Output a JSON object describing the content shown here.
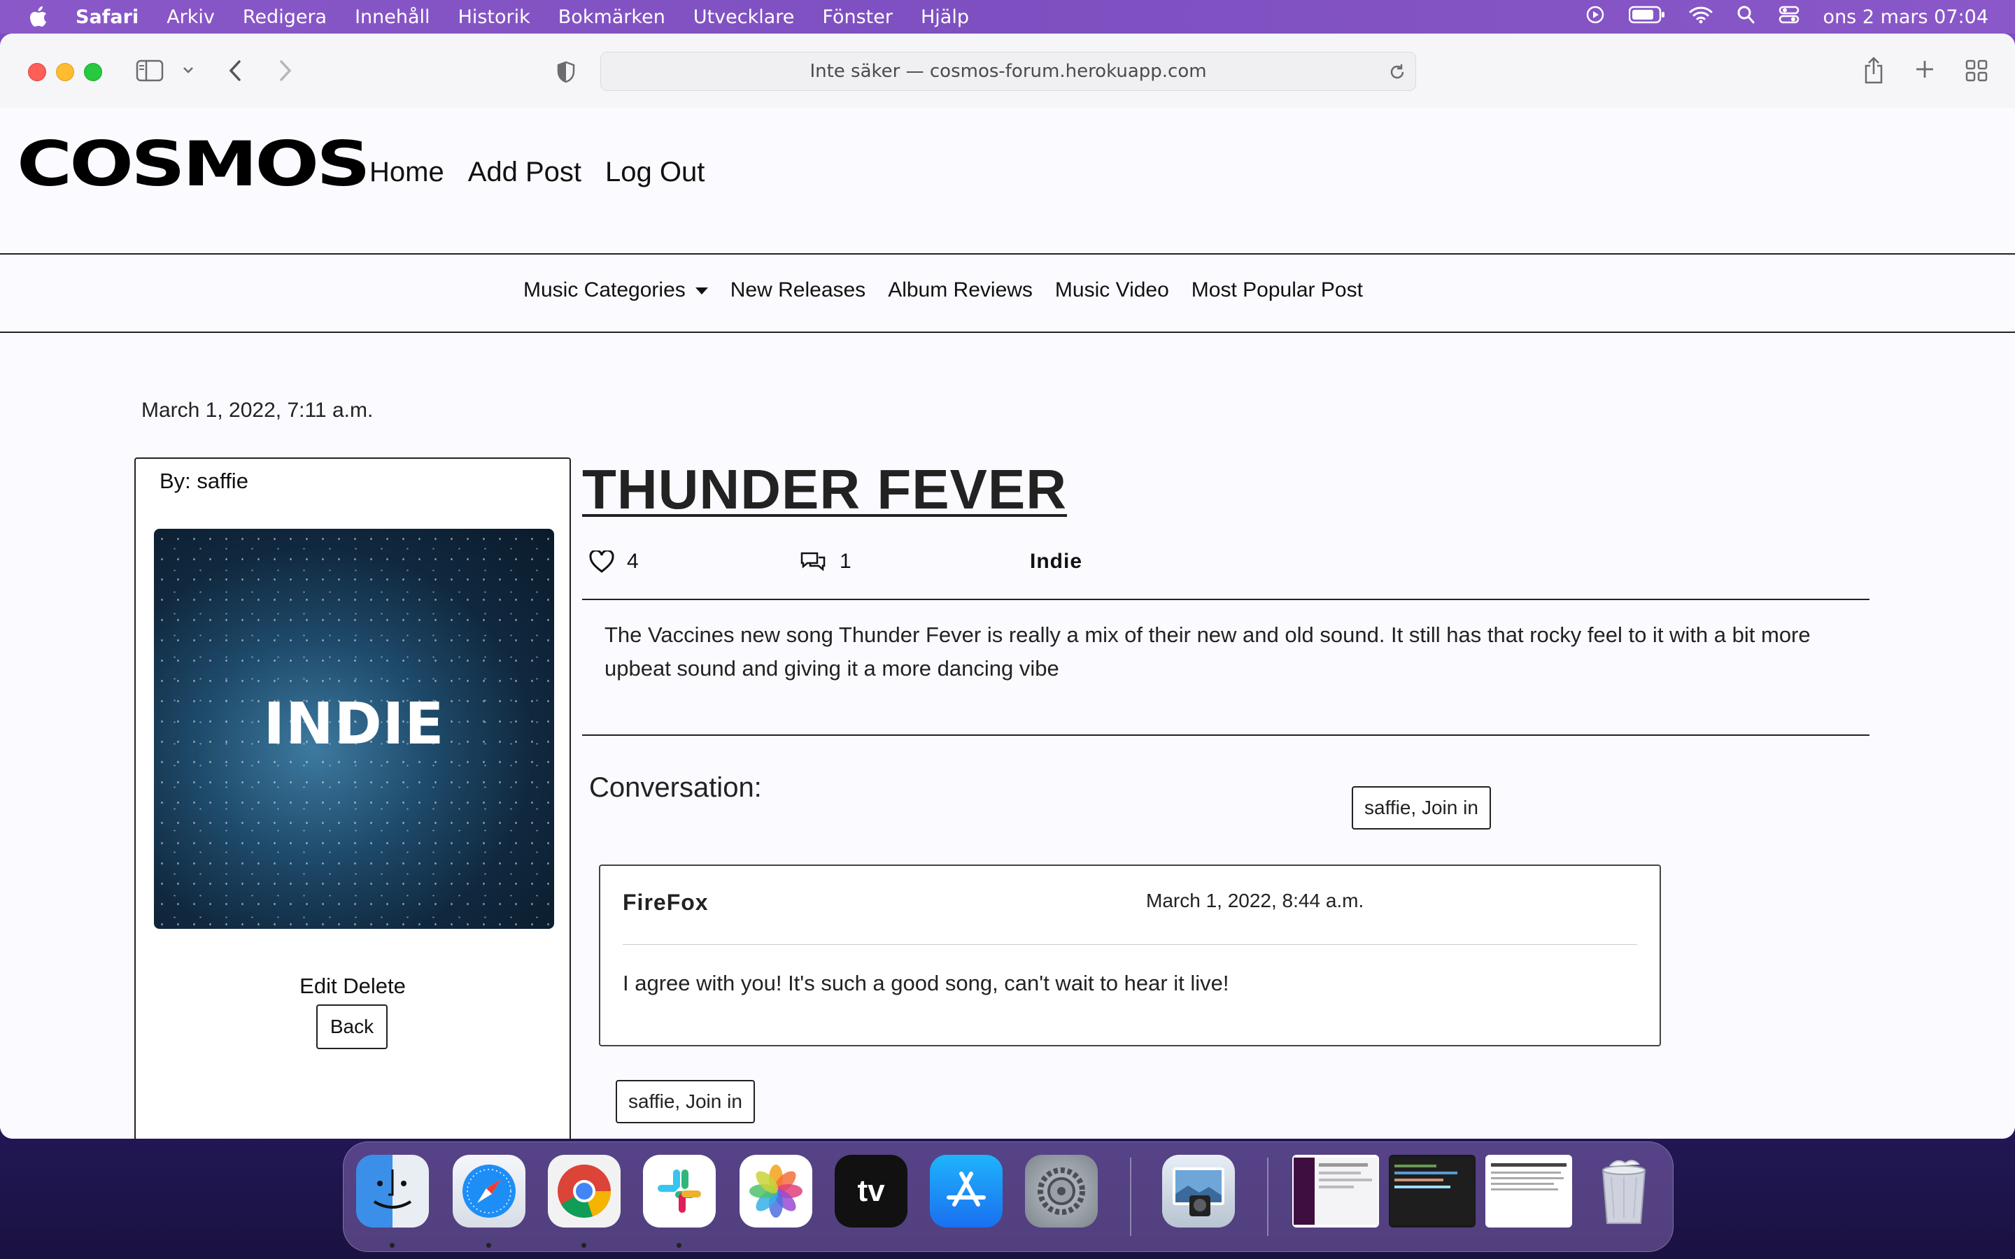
{
  "menubar": {
    "app": "Safari",
    "items": [
      "Arkiv",
      "Redigera",
      "Innehåll",
      "Historik",
      "Bokmärken",
      "Utvecklare",
      "Fönster",
      "Hjälp"
    ],
    "datetime": "ons 2 mars  07:04"
  },
  "browser": {
    "url": "Inte säker — cosmos-forum.herokuapp.com"
  },
  "site": {
    "logo": "COSMOS",
    "nav": [
      "Home",
      "Add Post",
      "Log Out"
    ],
    "categories": {
      "dropdown": "Music Categories",
      "links": [
        "New Releases",
        "Album Reviews",
        "Music Video",
        "Most Popular Post"
      ]
    }
  },
  "post": {
    "date": "March 1, 2022, 7:11 a.m.",
    "author": "By: saffie",
    "image_label": "INDIE",
    "edit_delete": "Edit Delete",
    "back": "Back",
    "title": "THUNDER FEVER",
    "likes": "4",
    "comments": "1",
    "category": "Indie",
    "body": "The Vaccines new song Thunder Fever is really a mix of their new and old sound. It still has that rocky feel to it with a bit more upbeat sound and giving it a more dancing vibe"
  },
  "conversation": {
    "title": "Conversation:",
    "join_top": "saffie, Join in",
    "join_bottom": "saffie, Join in",
    "comments": [
      {
        "author": "FireFox",
        "date": "March 1, 2022, 8:44 a.m.",
        "text": "I agree with you! It's such a good song, can't wait to hear it live!"
      }
    ]
  },
  "dock": {
    "apps": [
      "Finder",
      "Safari",
      "Chrome",
      "Slack",
      "Photos",
      "tv",
      "App Store",
      "System Preferences",
      "Preview",
      "Trash"
    ],
    "tv_label": "tv"
  },
  "colors": {
    "accent": "#222222",
    "menubar": "#7d4fc0",
    "page_bg": "#fbfaff"
  }
}
